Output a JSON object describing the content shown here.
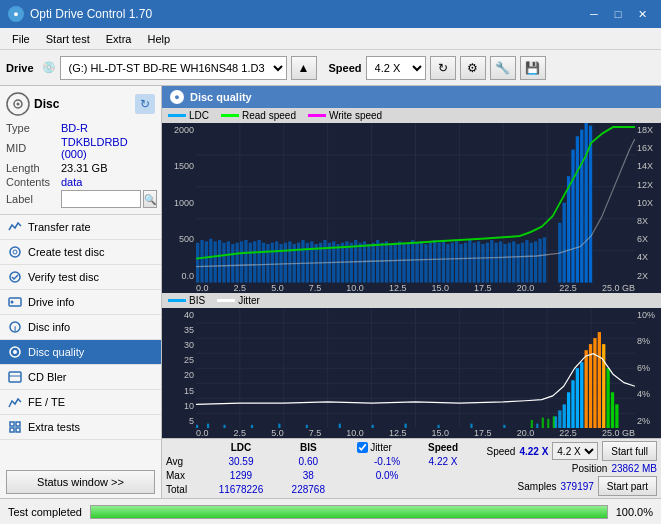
{
  "titleBar": {
    "title": "Opti Drive Control 1.70",
    "minBtn": "─",
    "maxBtn": "□",
    "closeBtn": "✕"
  },
  "menuBar": {
    "items": [
      "File",
      "Start test",
      "Extra",
      "Help"
    ]
  },
  "toolbar": {
    "driveLabel": "Drive",
    "driveValue": "(G:) HL-DT-ST BD-RE  WH16NS48 1.D3",
    "speedLabel": "Speed",
    "speedValue": "4.2 X"
  },
  "disc": {
    "title": "Disc",
    "typeLabel": "Type",
    "typeValue": "BD-R",
    "midLabel": "MID",
    "midValue": "TDKBLDRBD (000)",
    "lengthLabel": "Length",
    "lengthValue": "23.31 GB",
    "contentsLabel": "Contents",
    "contentsValue": "data",
    "labelLabel": "Label",
    "labelPlaceholder": ""
  },
  "navItems": [
    {
      "id": "transfer-rate",
      "label": "Transfer rate"
    },
    {
      "id": "create-test-disc",
      "label": "Create test disc"
    },
    {
      "id": "verify-test-disc",
      "label": "Verify test disc"
    },
    {
      "id": "drive-info",
      "label": "Drive info"
    },
    {
      "id": "disc-info",
      "label": "Disc info"
    },
    {
      "id": "disc-quality",
      "label": "Disc quality",
      "active": true
    },
    {
      "id": "cd-bler",
      "label": "CD Bler"
    },
    {
      "id": "fe-te",
      "label": "FE / TE"
    },
    {
      "id": "extra-tests",
      "label": "Extra tests"
    }
  ],
  "statusWindowBtn": "Status window >>",
  "discQuality": {
    "title": "Disc quality"
  },
  "legend1": {
    "items": [
      {
        "label": "LDC",
        "color": "#00aaff"
      },
      {
        "label": "Read speed",
        "color": "#00ff00"
      },
      {
        "label": "Write speed",
        "color": "#ff00ff"
      }
    ]
  },
  "legend2": {
    "items": [
      {
        "label": "BIS",
        "color": "#00aaff"
      },
      {
        "label": "Jitter",
        "color": "#ffffff"
      }
    ]
  },
  "chart1": {
    "yMax": 2000,
    "yLabels": [
      "2000",
      "1500",
      "1000",
      "500",
      "0.0"
    ],
    "yRightLabels": [
      "18X",
      "16X",
      "14X",
      "12X",
      "10X",
      "8X",
      "6X",
      "4X",
      "2X"
    ],
    "xLabels": [
      "0.0",
      "2.5",
      "5.0",
      "7.5",
      "10.0",
      "12.5",
      "15.0",
      "17.5",
      "20.0",
      "22.5",
      "25.0"
    ]
  },
  "chart2": {
    "yMax": 40,
    "yLabels": [
      "40",
      "35",
      "30",
      "25",
      "20",
      "15",
      "10",
      "5"
    ],
    "yRightLabels": [
      "10%",
      "8%",
      "6%",
      "4%",
      "2%"
    ],
    "xLabels": [
      "0.0",
      "2.5",
      "5.0",
      "7.5",
      "10.0",
      "12.5",
      "15.0",
      "17.5",
      "20.0",
      "22.5",
      "25.0"
    ]
  },
  "stats": {
    "headers": [
      "",
      "LDC",
      "BIS",
      "",
      "Jitter",
      "Speed",
      ""
    ],
    "avg": {
      "label": "Avg",
      "ldc": "30.59",
      "bis": "0.60",
      "jitter": "-0.1%",
      "speed": "4.22 X"
    },
    "max": {
      "label": "Max",
      "ldc": "1299",
      "bis": "38",
      "jitter": "0.0%"
    },
    "total": {
      "label": "Total",
      "ldc": "11678226",
      "bis": "228768"
    },
    "position": {
      "label": "Position",
      "value": "23862 MB"
    },
    "samples": {
      "label": "Samples",
      "value": "379197"
    },
    "speedSelect": "4.2 X",
    "startFullBtn": "Start full",
    "startPartBtn": "Start part"
  },
  "statusBar": {
    "text": "Test completed",
    "progress": "100.0%"
  },
  "colors": {
    "background": "#1a2035",
    "gridLine": "#2a3550",
    "ldcLine": "#00aaff",
    "readSpeedLine": "#00ff00",
    "bisLine": "#00aaff",
    "jitterLine": "#ffffff",
    "accent": "#2d6db5",
    "sidebarActive": "#2d6db5"
  }
}
